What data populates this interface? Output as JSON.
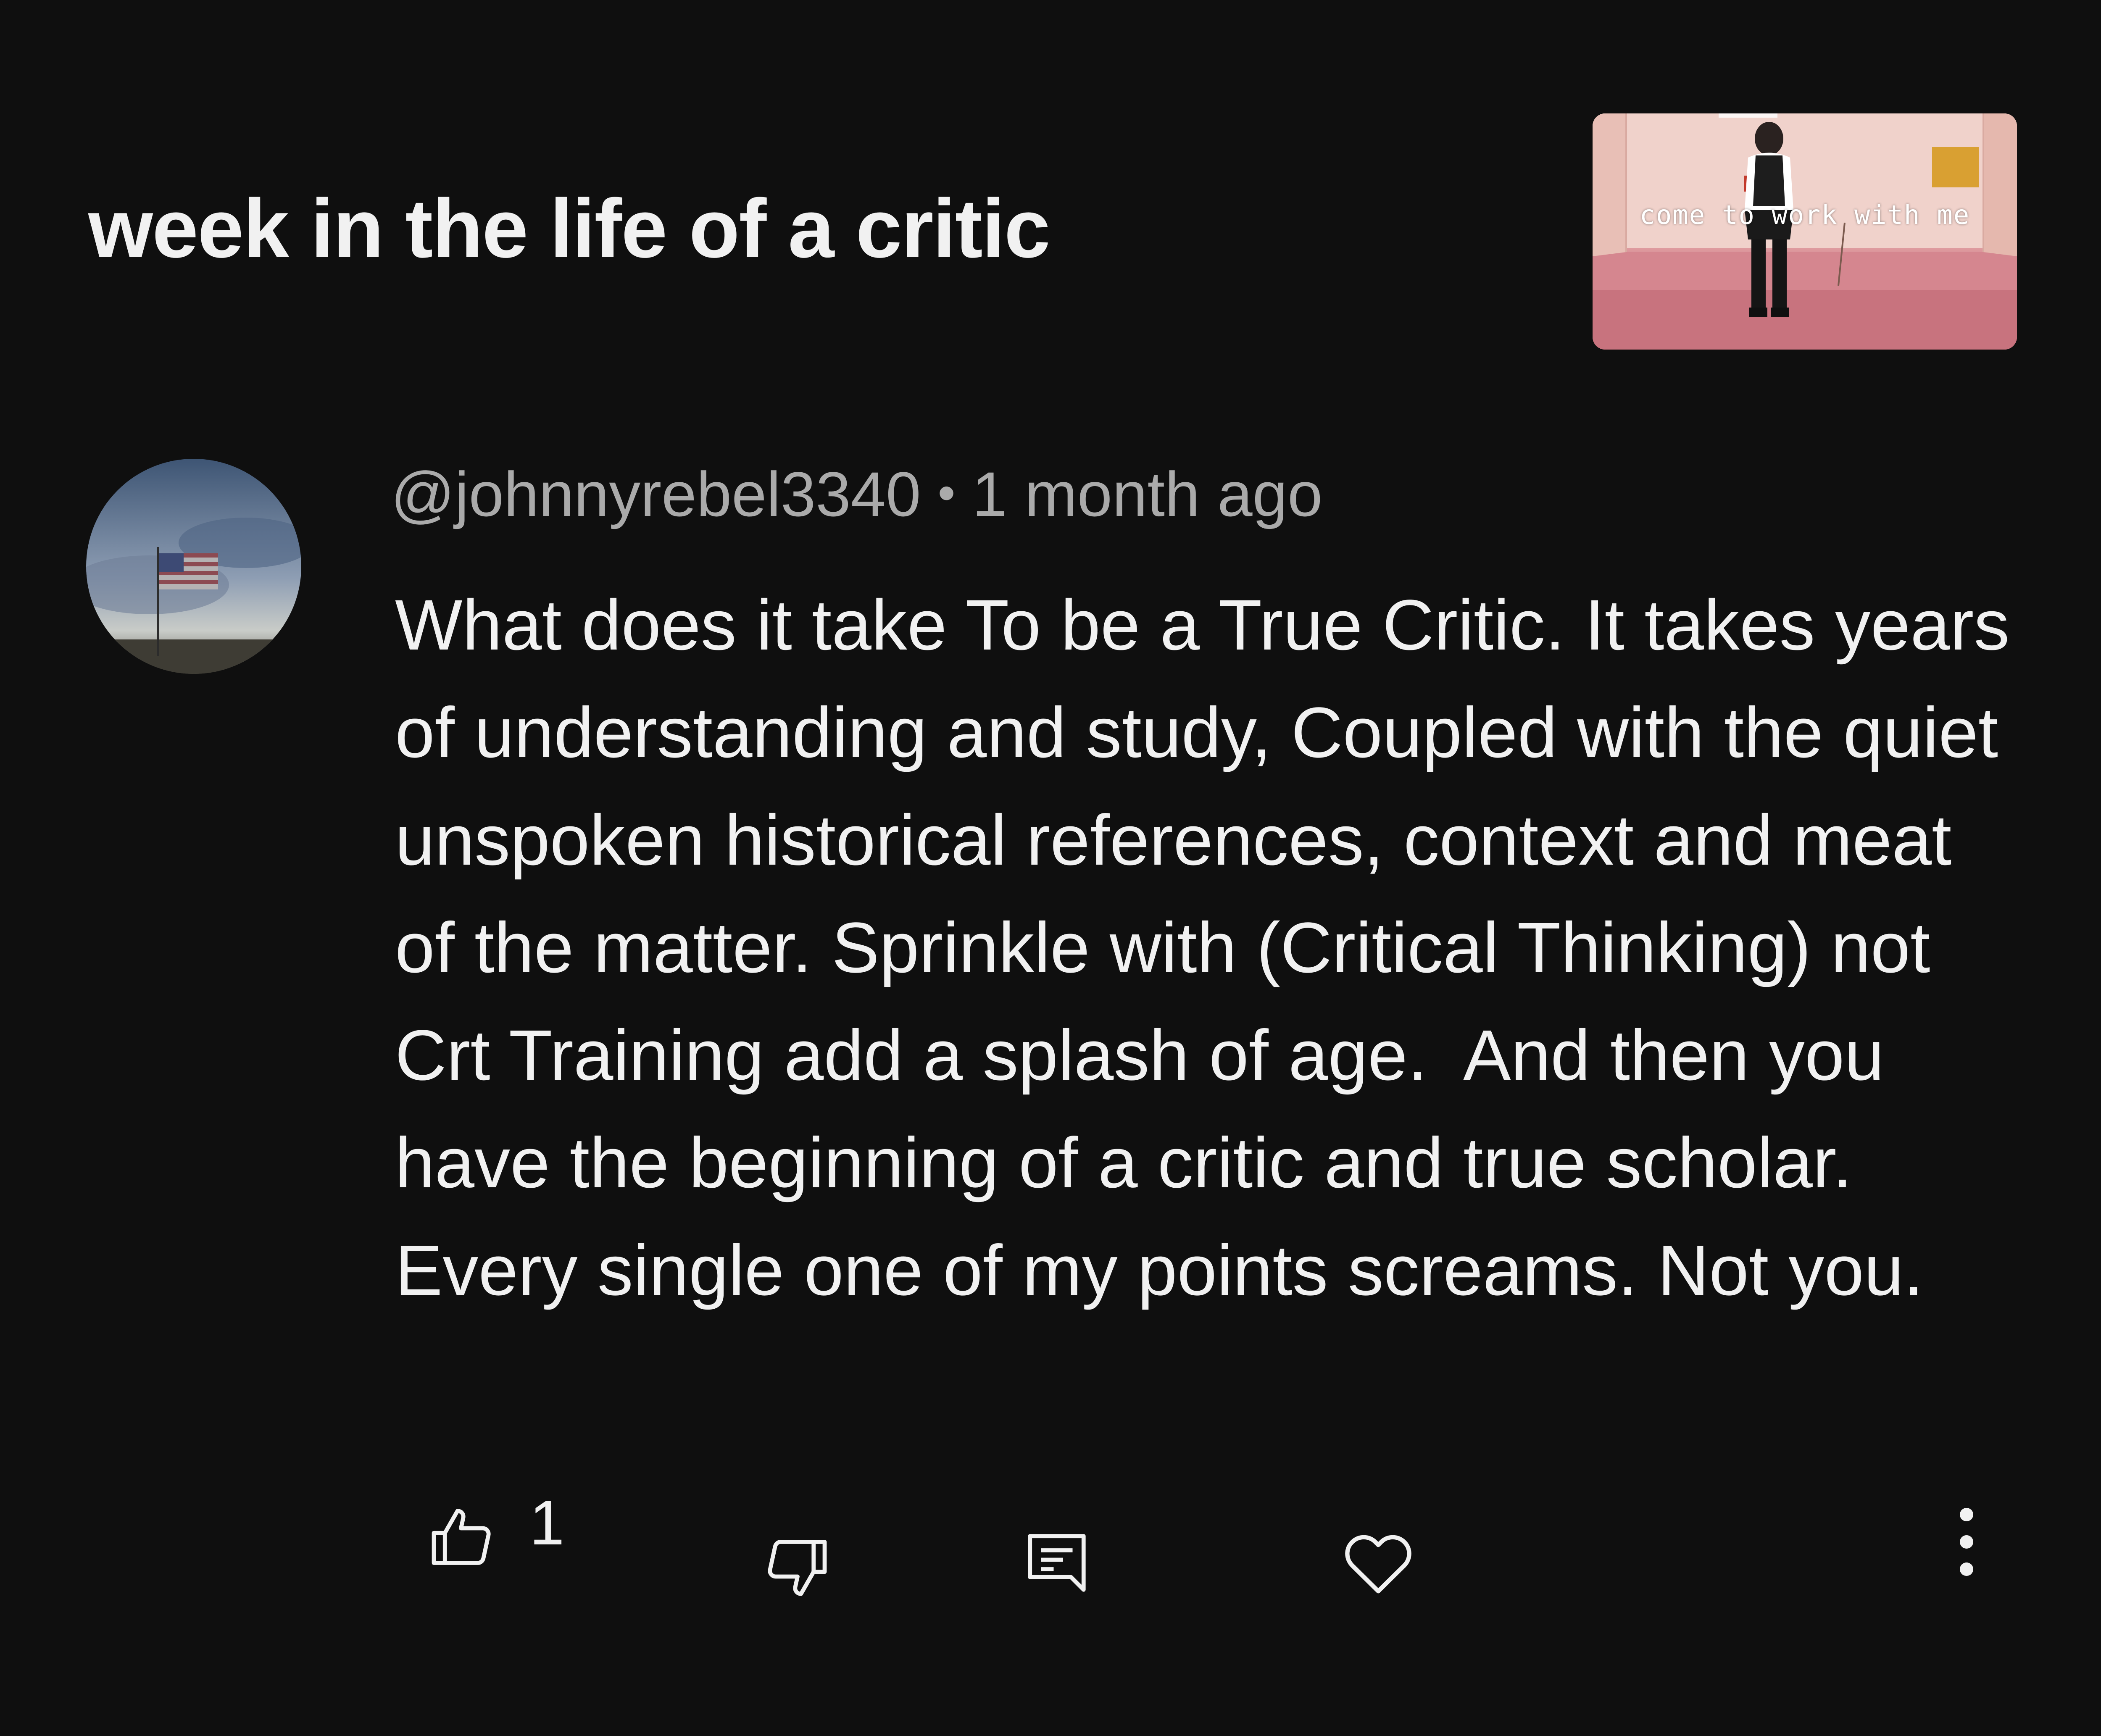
{
  "video": {
    "title": "week in the life of a critic",
    "thumbnail_caption": "come to work with me"
  },
  "comment": {
    "author": "@johnnyrebel3340",
    "separator": "•",
    "timestamp": "1 month ago",
    "text": "What does it take To be a True Critic. It takes years of understanding and study, Coupled with the quiet unspoken historical references, context and meat of the matter. Sprinkle with (Critical Thinking) not Crt Training add a splash of age.  And then you have the beginning of a critic and true scholar.  Every single one of my points screams. Not you.",
    "like_count": "1"
  },
  "icons": [
    "thumbs-up-icon",
    "thumbs-down-icon",
    "reply-icon",
    "heart-icon",
    "more-vert-icon"
  ],
  "colors": {
    "background": "#0f0f0f",
    "primary_text": "#f1f1f1",
    "secondary_text": "#aaaaaa"
  }
}
